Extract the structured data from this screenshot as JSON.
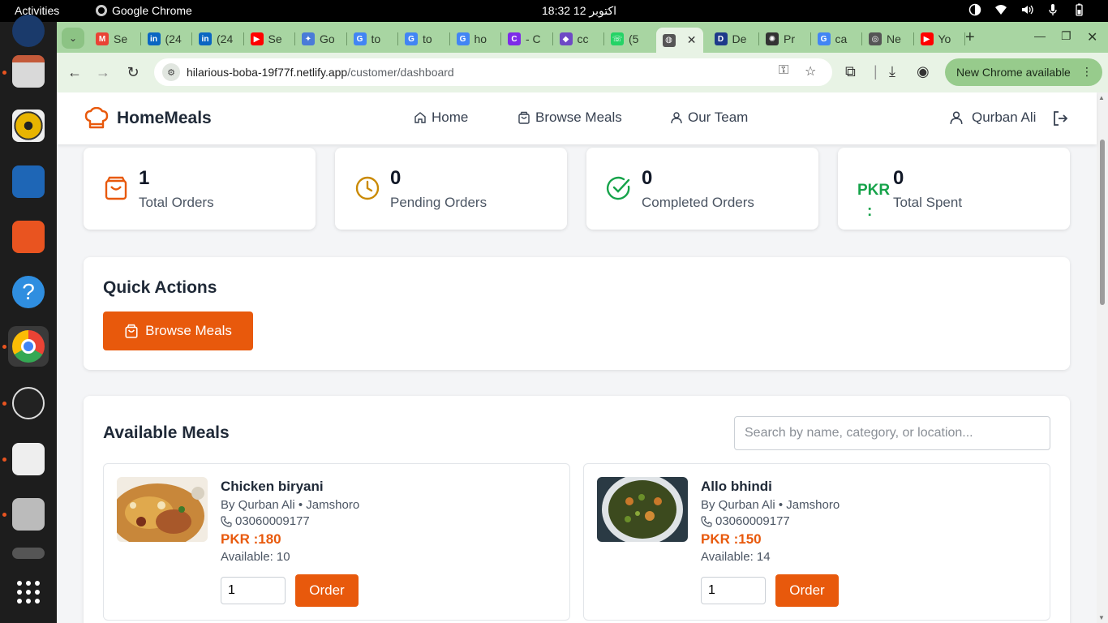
{
  "os": {
    "activities": "Activities",
    "app_name": "Google Chrome",
    "clock": "18:32  12 اکتوبر"
  },
  "chrome": {
    "tabs": [
      {
        "label": "Se",
        "favicon": "gmail-icon",
        "color": "#ea4335"
      },
      {
        "label": "(24",
        "favicon": "linkedin-icon",
        "color": "#0a66c2"
      },
      {
        "label": "(24",
        "favicon": "linkedin-icon",
        "color": "#0a66c2"
      },
      {
        "label": "Se",
        "favicon": "youtube-icon",
        "color": "#ff0000"
      },
      {
        "label": "Go",
        "favicon": "gemini-icon",
        "color": "#4a7bd8"
      },
      {
        "label": "to",
        "favicon": "google-icon",
        "color": "#4285f4"
      },
      {
        "label": "to",
        "favicon": "google-icon",
        "color": "#4285f4"
      },
      {
        "label": "ho",
        "favicon": "google-icon",
        "color": "#4285f4"
      },
      {
        "label": "- C",
        "favicon": "canva-icon",
        "color": "#7d2ae8"
      },
      {
        "label": "cc",
        "favicon": "copilot-icon",
        "color": "#6e49c5"
      },
      {
        "label": "(5",
        "favicon": "whatsapp-icon",
        "color": "#25d366"
      },
      {
        "label": "",
        "favicon": "globe-icon",
        "color": "#555555",
        "active": true
      },
      {
        "label": "De",
        "favicon": "deepseek-icon",
        "color": "#1e3a8a"
      },
      {
        "label": "Pr",
        "favicon": "openai-icon",
        "color": "#333333"
      },
      {
        "label": "ca",
        "favicon": "google-icon",
        "color": "#4285f4"
      },
      {
        "label": "Ne",
        "favicon": "chrome-icon",
        "color": "#555555"
      },
      {
        "label": "Yo",
        "favicon": "youtube-icon",
        "color": "#ff0000"
      }
    ],
    "url_host": "hilarious-boba-19f77f.netlify.app",
    "url_path": "/customer/dashboard",
    "update_label": "New Chrome available"
  },
  "navbar": {
    "brand": "HomeMeals",
    "links": {
      "home": "Home",
      "browse": "Browse Meals",
      "team": "Our Team"
    },
    "user": "Qurban Ali"
  },
  "stats": {
    "total_orders": {
      "value": "1",
      "label": "Total Orders"
    },
    "pending_orders": {
      "value": "0",
      "label": "Pending Orders"
    },
    "completed_orders": {
      "value": "0",
      "label": "Completed Orders"
    },
    "total_spent": {
      "value": "0",
      "label": "Total Spent",
      "currency": "PKR",
      "suffix": ":"
    }
  },
  "quick_actions": {
    "title": "Quick Actions",
    "browse_button": "Browse Meals"
  },
  "available_meals": {
    "title": "Available Meals",
    "search_placeholder": "Search by name, category, or location...",
    "meals": [
      {
        "name": "Chicken biryani",
        "meta": "By Qurban Ali • Jamshoro",
        "phone": "03060009177",
        "price": "PKR :180",
        "available": "Available: 10",
        "qty": "1",
        "order_label": "Order"
      },
      {
        "name": "Allo bhindi",
        "meta": "By Qurban Ali • Jamshoro",
        "phone": "03060009177",
        "price": "PKR :150",
        "available": "Available: 14",
        "qty": "1",
        "order_label": "Order"
      }
    ]
  },
  "colors": {
    "accent": "#e8590c",
    "green": "#16a34a",
    "tabstrip": "#a8d5a2"
  }
}
